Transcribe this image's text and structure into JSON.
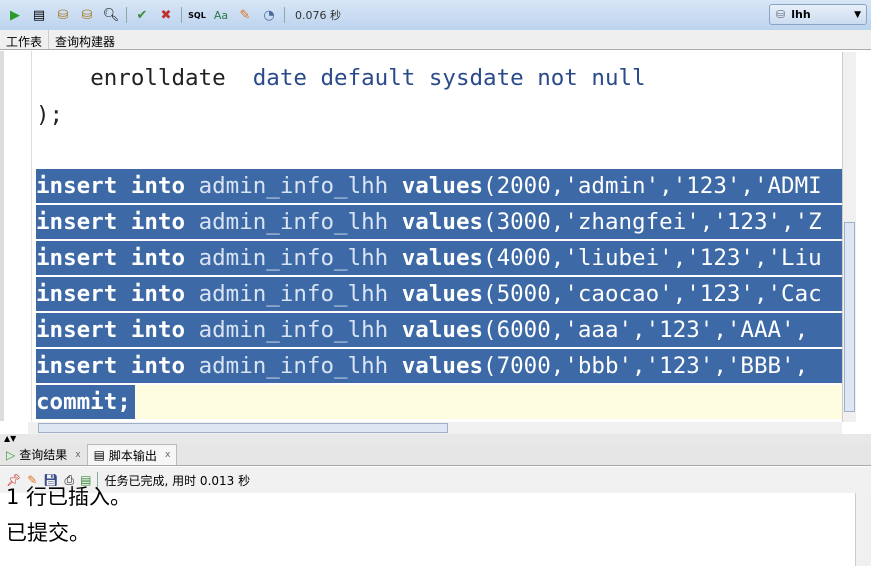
{
  "toolbar": {
    "icons": [
      "run-icon",
      "run-script-icon",
      "commit-icon",
      "rollback-icon",
      "explain-plan-icon",
      "autotrace-icon",
      "clear-icon",
      "sql-history-icon",
      "uppercase-icon",
      "eraser-icon",
      "sql-tuning-icon"
    ],
    "time": "0.076 秒",
    "connection": "lhh"
  },
  "worksheet_tabs": [
    "工作表",
    "查询构建器"
  ],
  "editor": {
    "line1": {
      "name": "enrolldate",
      "rest": "date default sysdate not null"
    },
    "line2": ");",
    "inserts": [
      {
        "kw1": "insert",
        "kw2": "into",
        "table": "admin_info_lhh",
        "kw3": "values",
        "vals": "(2000,'admin','123','ADMI"
      },
      {
        "kw1": "insert",
        "kw2": "into",
        "table": "admin_info_lhh",
        "kw3": "values",
        "vals": "(3000,'zhangfei','123','Z"
      },
      {
        "kw1": "insert",
        "kw2": "into",
        "table": "admin_info_lhh",
        "kw3": "values",
        "vals": "(4000,'liubei','123','Liu"
      },
      {
        "kw1": "insert",
        "kw2": "into",
        "table": "admin_info_lhh",
        "kw3": "values",
        "vals": "(5000,'caocao','123','Cac"
      },
      {
        "kw1": "insert",
        "kw2": "into",
        "table": "admin_info_lhh",
        "kw3": "values",
        "vals": "(6000,'aaa','123','AAA',"
      },
      {
        "kw1": "insert",
        "kw2": "into",
        "table": "admin_info_lhh",
        "kw3": "values",
        "vals": "(7000,'bbb','123','BBB',"
      }
    ],
    "commit": "commit;"
  },
  "bottom_tabs": [
    {
      "label": "查询结果",
      "close": "x"
    },
    {
      "label": "脚本输出",
      "close": "x"
    }
  ],
  "output_toolbar": {
    "status": "任务已完成, 用时 0.013 秒"
  },
  "output": [
    "1 行已插入。",
    "已提交。"
  ],
  "colors": {
    "selection": "#3d6aa6",
    "toolbar": "#c8dbf2",
    "keyword": "#2a4a8a"
  }
}
